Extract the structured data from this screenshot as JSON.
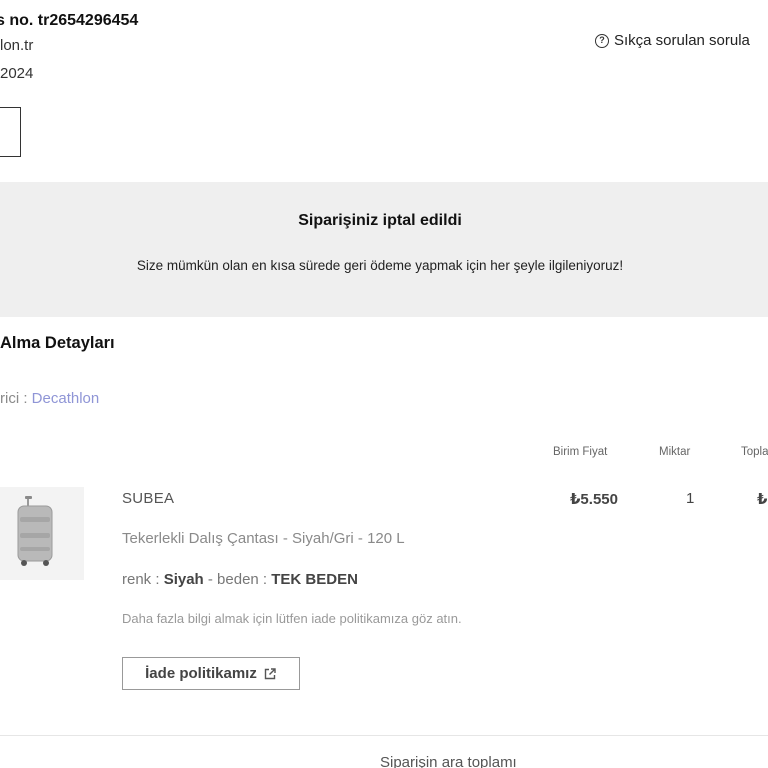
{
  "header": {
    "order_number": "s no. tr2654296454",
    "seller_site": "lon.tr",
    "order_date": "2024",
    "faq_link": "Sıkça sorulan sorula"
  },
  "banner": {
    "title": "Siparişiniz iptal edildi",
    "message": "Size mümkün olan en kısa sürede geri ödeme yapmak için her şeyle ilgileniyoruz!"
  },
  "delivery": {
    "section_title": "Alma Detayları",
    "seller_label": "rici : ",
    "seller_name": "Decathlon"
  },
  "table": {
    "headers": [
      "Birim Fiyat",
      "Miktar",
      "Topla"
    ]
  },
  "item": {
    "brand": "SUBEA",
    "unit_price": "₺5.550",
    "quantity": "1",
    "total": "₺",
    "description": "Tekerlekli Dalış Çantası - Siyah/Gri - 120 L",
    "color_label": "renk : ",
    "color_value": "Siyah",
    "size_label": " - beden : ",
    "size_value": "TEK BEDEN",
    "note": "Daha fazla bilgi almak için lütfen iade politikamıza göz atın.",
    "return_policy_label": "İade politikamız",
    "image_icon": "luggage-icon"
  },
  "summary": {
    "subtotal_label": "Siparişin ara toplamı"
  }
}
